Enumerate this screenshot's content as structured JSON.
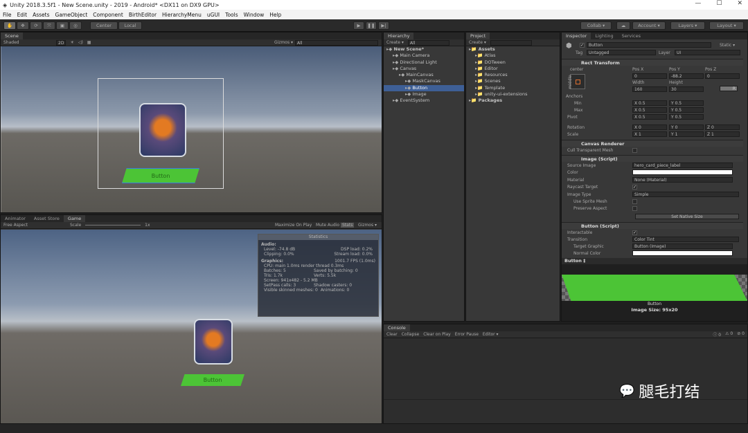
{
  "window": {
    "title": "Unity 2018.3.5f1 - New Scene.unity - 2019 - Android* <DX11 on DX9 GPU>"
  },
  "menu": [
    "File",
    "Edit",
    "Assets",
    "GameObject",
    "Component",
    "BirthEditor",
    "HierarchyMenu",
    "uGUI",
    "Tools",
    "Window",
    "Help"
  ],
  "toolbar": {
    "pivot": "Center",
    "space": "Local",
    "collab": "Collab ▾",
    "account": "Account ▾",
    "layers": "Layers ▾",
    "layout": "Layout ▾"
  },
  "scene": {
    "tab": "Scene",
    "shading": "Shaded",
    "mode2d": "2D",
    "gizmos": "Gizmos ▾",
    "search": "All",
    "button_label": "Button"
  },
  "bottom_tabs": [
    "Animator",
    "Asset Store",
    "Game"
  ],
  "game": {
    "aspect": "Free Aspect",
    "scale_label": "Scale",
    "scale_value": "1x",
    "maximize": "Maximize On Play",
    "mute": "Mute Audio",
    "stats": "Stats",
    "gizmos": "Gizmos ▾",
    "button_label": "Button"
  },
  "statistics": {
    "title": "Statistics",
    "audio": "Audio:",
    "level": "Level: -74.8 dB",
    "dsp": "DSP load: 0.2%",
    "clipping": "Clipping: 0.0%",
    "stream": "Stream load: 0.0%",
    "graphics": "Graphics:",
    "fps": "1001.7 FPS (1.0ms)",
    "cpu": "CPU: main 1.0ms  render thread 0.3ms",
    "batches": "Batches: 5",
    "saved": "Saved by batching: 0",
    "tris": "Tris: 1.7k",
    "verts": "Verts: 5.5k",
    "screen": "Screen: 941x482 - 5.2 MB",
    "setpass": "SetPass calls: 3",
    "shadow": "Shadow casters: 0",
    "skinned": "Visible skinned meshes: 0",
    "animations": "Animations: 0"
  },
  "hierarchy": {
    "tab": "Hierarchy",
    "create": "Create ▾",
    "search": "All",
    "items": [
      {
        "label": "New Scene*",
        "depth": 0
      },
      {
        "label": "Main Camera",
        "depth": 1
      },
      {
        "label": "Directional Light",
        "depth": 1
      },
      {
        "label": "Canvas",
        "depth": 1
      },
      {
        "label": "MainCanvas",
        "depth": 2
      },
      {
        "label": "MaskCanvas",
        "depth": 3
      },
      {
        "label": "Button",
        "depth": 3,
        "selected": true
      },
      {
        "label": "Image",
        "depth": 3
      },
      {
        "label": "EventSystem",
        "depth": 1
      }
    ]
  },
  "project": {
    "tab": "Project",
    "create": "Create ▾",
    "items": [
      {
        "label": "Assets",
        "depth": 0
      },
      {
        "label": "Atlas",
        "depth": 1
      },
      {
        "label": "DOTween",
        "depth": 1
      },
      {
        "label": "Editor",
        "depth": 1
      },
      {
        "label": "Resources",
        "depth": 1
      },
      {
        "label": "Scenes",
        "depth": 1
      },
      {
        "label": "Template",
        "depth": 1
      },
      {
        "label": "unity-ui-extensions",
        "depth": 1
      },
      {
        "label": "Packages",
        "depth": 0
      }
    ]
  },
  "inspector": {
    "tabs": [
      "Inspector",
      "Lighting",
      "Services"
    ],
    "name": "Button",
    "static": "Static ▾",
    "tag_label": "Tag",
    "tag": "Untagged",
    "layer_label": "Layer",
    "layer": "UI",
    "rect": {
      "title": "Rect Transform",
      "anchor_h": "center",
      "anchor_v": "middle",
      "posx_l": "Pos X",
      "posy_l": "Pos Y",
      "posz_l": "Pos Z",
      "posx": "0",
      "posy": "-88.2",
      "posz": "0",
      "width_l": "Width",
      "height_l": "Height",
      "width": "160",
      "height": "30",
      "anchors": "Anchors",
      "min": "Min",
      "max": "Max",
      "pivot": "Pivot",
      "rotation": "Rotation",
      "scale": "Scale",
      "min_x": "X 0.5",
      "min_y": "Y 0.5",
      "max_x": "X 0.5",
      "max_y": "Y 0.5",
      "piv_x": "X 0.5",
      "piv_y": "Y 0.5",
      "rot_x": "X 0",
      "rot_y": "Y 0",
      "rot_z": "Z 0",
      "sc_x": "X 1",
      "sc_y": "Y 1",
      "sc_z": "Z 1",
      "r_btn": "R"
    },
    "canvas_renderer": {
      "title": "Canvas Renderer",
      "cull": "Cull Transparent Mesh"
    },
    "image": {
      "title": "Image (Script)",
      "source_l": "Source Image",
      "source": "hero_card_piece_label",
      "color_l": "Color",
      "material_l": "Material",
      "material": "None (Material)",
      "raycast_l": "Raycast Target",
      "type_l": "Image Type",
      "type": "Simple",
      "sprite_mesh": "Use Sprite Mesh",
      "preserve": "Preserve Aspect",
      "native": "Set Native Size"
    },
    "button": {
      "title": "Button (Script)",
      "interactable": "Interactable",
      "transition_l": "Transition",
      "transition": "Color Tint",
      "target_l": "Target Graphic",
      "target": "Button (Image)",
      "normal_l": "Normal Color"
    },
    "preview": {
      "header": "Button ‡",
      "label": "Button",
      "size": "Image Size: 95x20"
    }
  },
  "console": {
    "tab": "Console",
    "buttons": [
      "Clear",
      "Collapse",
      "Clear on Play",
      "Error Pause",
      "Editor ▾"
    ],
    "info": "0",
    "warn": "0",
    "error": "0"
  },
  "watermark": "腿毛打结"
}
